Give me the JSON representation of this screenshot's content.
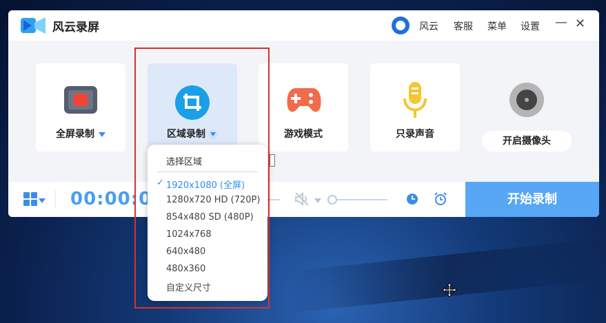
{
  "app": {
    "title": "风云录屏"
  },
  "titlebar": {
    "username": "风云",
    "service": "客服",
    "menu": "菜单",
    "settings": "设置"
  },
  "modes": [
    {
      "label": "全屏录制",
      "icon": "fullscreen-record-icon",
      "has_dropdown": true
    },
    {
      "label": "区域录制",
      "icon": "region-crop-icon",
      "has_dropdown": true,
      "active": true
    },
    {
      "label": "游戏模式",
      "icon": "gamepad-icon"
    },
    {
      "label": "只录声音",
      "icon": "microphone-icon"
    }
  ],
  "camera": {
    "label": "开启摄像头",
    "icon": "camera-icon"
  },
  "bottom": {
    "timer": "00:00:00",
    "start_label": "开始录制",
    "volume_level": 0
  },
  "dropdown": {
    "header": "选择区域",
    "items": [
      "1920x1080 (全屏)",
      "1280x720 HD (720P)",
      "854x480 SD (480P)",
      "1024x768",
      "640x480",
      "480x360",
      "自定义尺寸"
    ],
    "selected_index": 0
  },
  "colors": {
    "accent": "#58a7f5",
    "timer": "#4b9ef0",
    "highlight": "#d9302c"
  }
}
